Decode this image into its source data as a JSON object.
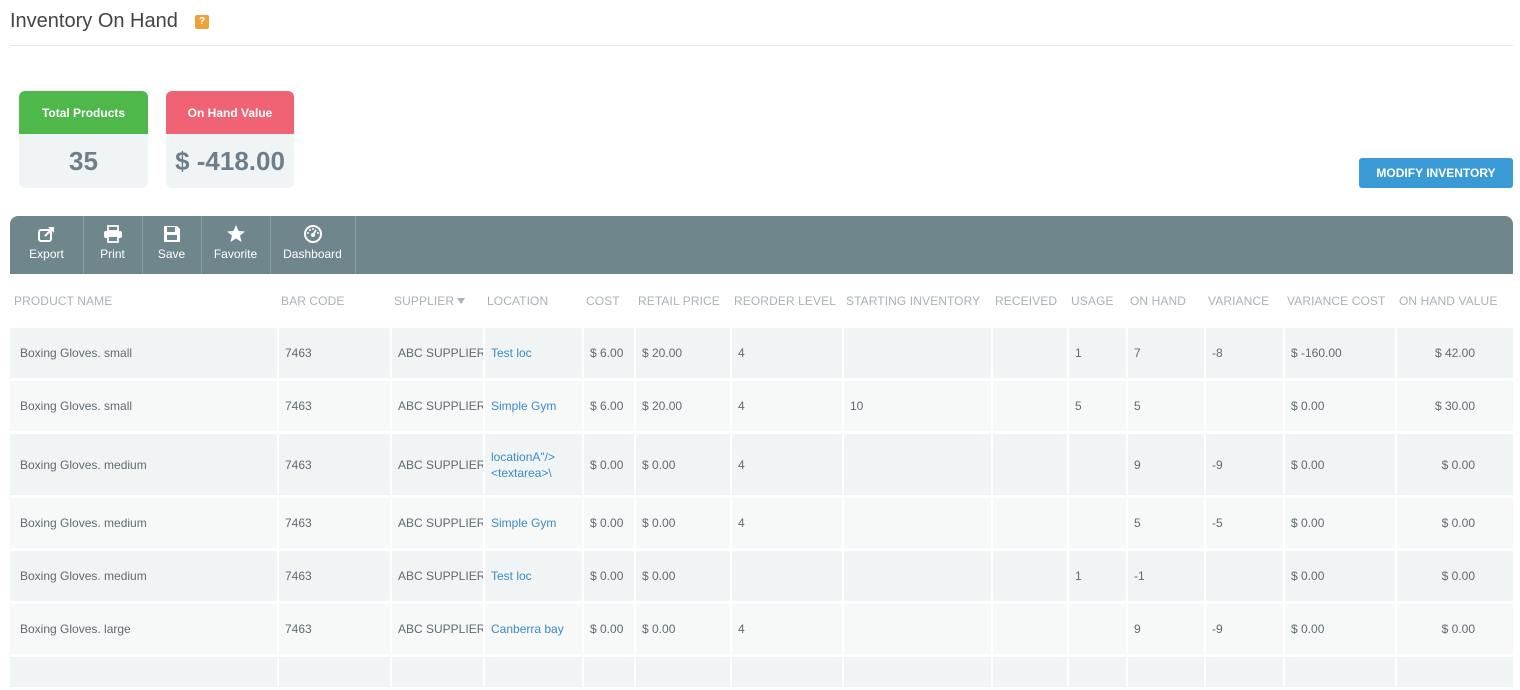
{
  "page": {
    "title": "Inventory On Hand",
    "help_glyph": "?"
  },
  "cards": {
    "total_products": {
      "label": "Total Products",
      "value": "35",
      "color": "#4fb84a"
    },
    "on_hand_value": {
      "label": "On Hand Value",
      "value": "$ -418.00",
      "color": "#f06374"
    }
  },
  "actions": {
    "modify_inventory": "MODIFY INVENTORY"
  },
  "toolbar": {
    "export": "Export",
    "print": "Print",
    "save": "Save",
    "favorite": "Favorite",
    "dashboard": "Dashboard"
  },
  "table": {
    "columns": [
      "PRODUCT NAME",
      "BAR CODE",
      "SUPPLIER",
      "LOCATION",
      "COST",
      "RETAIL PRICE",
      "REORDER LEVEL",
      "STARTING INVENTORY",
      "RECEIVED",
      "USAGE",
      "ON HAND",
      "VARIANCE",
      "VARIANCE COST",
      "ON HAND VALUE"
    ],
    "rows": [
      [
        "Boxing Gloves. small",
        "7463",
        "ABC SUPPLIER!",
        "Test loc",
        "$ 6.00",
        "$ 20.00",
        "4",
        "",
        "",
        "1",
        "7",
        "-8",
        "$ -160.00",
        "$ 42.00"
      ],
      [
        "Boxing Gloves. small",
        "7463",
        "ABC SUPPLIER!",
        "Simple Gym",
        "$ 6.00",
        "$ 20.00",
        "4",
        "10",
        "",
        "5",
        "5",
        "",
        "$ 0.00",
        "$ 30.00"
      ],
      [
        "Boxing Gloves. medium",
        "7463",
        "ABC SUPPLIER!",
        "locationA\"/> <textarea>\\",
        "$ 0.00",
        "$ 0.00",
        "4",
        "",
        "",
        "",
        "9",
        "-9",
        "$ 0.00",
        "$ 0.00"
      ],
      [
        "Boxing Gloves. medium",
        "7463",
        "ABC SUPPLIER!",
        "Simple Gym",
        "$ 0.00",
        "$ 0.00",
        "4",
        "",
        "",
        "",
        "5",
        "-5",
        "$ 0.00",
        "$ 0.00"
      ],
      [
        "Boxing Gloves. medium",
        "7463",
        "ABC SUPPLIER!",
        "Test loc",
        "$ 0.00",
        "$ 0.00",
        "",
        "",
        "",
        "1",
        "-1",
        "",
        "$ 0.00",
        "$ 0.00"
      ],
      [
        "Boxing Gloves. large",
        "7463",
        "ABC SUPPLIER!",
        "Canberra bay",
        "$ 0.00",
        "$ 0.00",
        "4",
        "",
        "",
        "",
        "9",
        "-9",
        "$ 0.00",
        "$ 0.00"
      ],
      [
        "",
        "",
        "",
        "",
        "",
        "",
        "",
        "",
        "",
        "",
        "",
        "",
        "",
        ""
      ]
    ]
  }
}
